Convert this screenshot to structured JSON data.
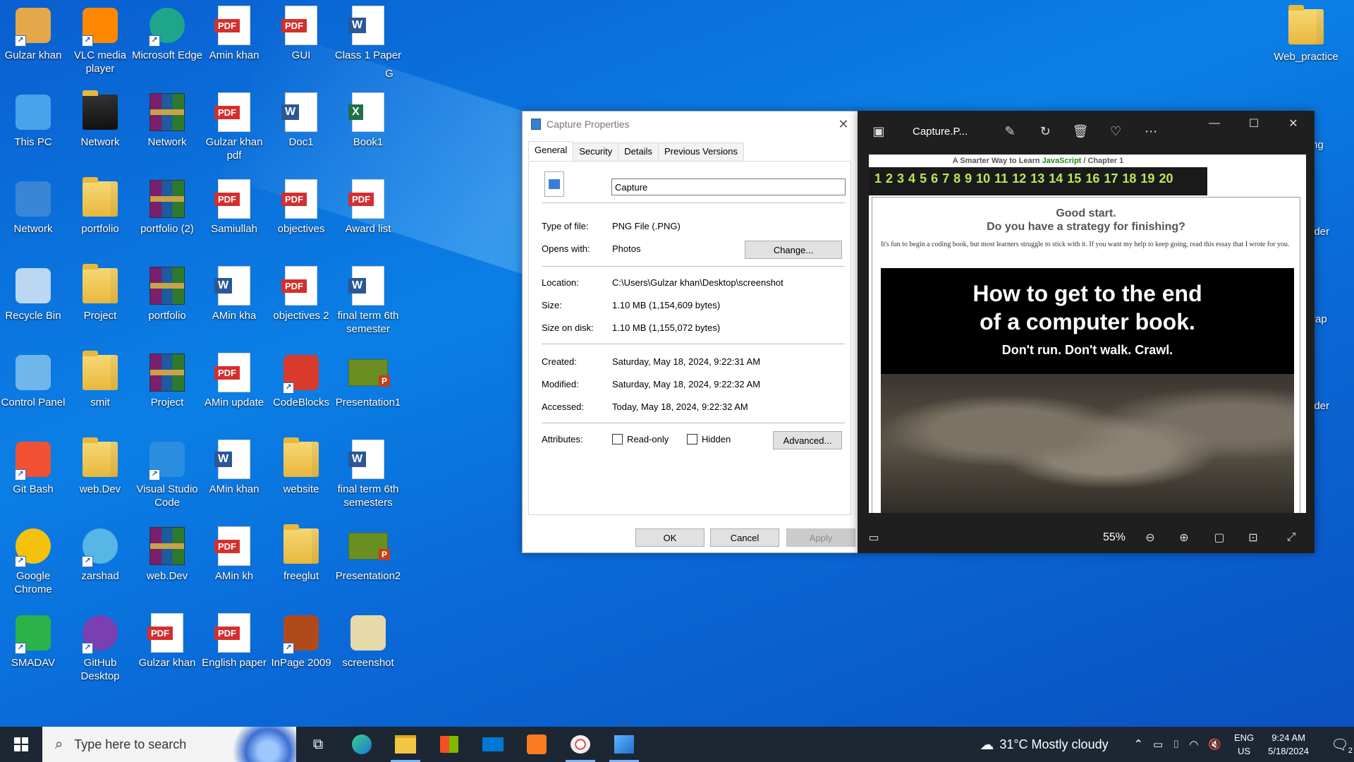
{
  "desktop": {
    "icons": [
      {
        "label": "Gulzar khan",
        "type": "user"
      },
      {
        "label": "VLC media player",
        "type": "vlc"
      },
      {
        "label": "Microsoft Edge",
        "type": "edge"
      },
      {
        "label": "Amin khan",
        "type": "pdf"
      },
      {
        "label": "GUI",
        "type": "pdf"
      },
      {
        "label": "Class 1 Paper",
        "type": "word"
      },
      {
        "label": "This PC",
        "type": "pc"
      },
      {
        "label": "Network",
        "type": "network-folder"
      },
      {
        "label": "Network",
        "type": "rar"
      },
      {
        "label": "Gulzar khan pdf",
        "type": "pdf"
      },
      {
        "label": "Doc1",
        "type": "word"
      },
      {
        "label": "Book1",
        "type": "excel"
      },
      {
        "label": "Network",
        "type": "network"
      },
      {
        "label": "portfolio",
        "type": "folder"
      },
      {
        "label": "portfolio (2)",
        "type": "rar"
      },
      {
        "label": "Samiullah",
        "type": "pdf"
      },
      {
        "label": "objectives",
        "type": "pdf"
      },
      {
        "label": "Award list",
        "type": "pdf"
      },
      {
        "label": "Recycle Bin",
        "type": "recycle"
      },
      {
        "label": "Project",
        "type": "folder"
      },
      {
        "label": "portfolio",
        "type": "rar"
      },
      {
        "label": "AMin kha",
        "type": "word"
      },
      {
        "label": "objectives 2",
        "type": "pdf"
      },
      {
        "label": "final term 6th semester",
        "type": "word"
      },
      {
        "label": "Control Panel",
        "type": "control"
      },
      {
        "label": "smit",
        "type": "folder"
      },
      {
        "label": "Project",
        "type": "rar"
      },
      {
        "label": "AMin update",
        "type": "pdf"
      },
      {
        "label": "CodeBlocks",
        "type": "codeblocks"
      },
      {
        "label": "Presentation1",
        "type": "ppt"
      },
      {
        "label": "Git Bash",
        "type": "git"
      },
      {
        "label": "web.Dev",
        "type": "folder"
      },
      {
        "label": "Visual Studio Code",
        "type": "vscode"
      },
      {
        "label": "AMin khan",
        "type": "word"
      },
      {
        "label": "website",
        "type": "folder"
      },
      {
        "label": "final term 6th semesters",
        "type": "word"
      },
      {
        "label": "Google Chrome",
        "type": "chrome"
      },
      {
        "label": "zarshad",
        "type": "edge-doc"
      },
      {
        "label": "web.Dev",
        "type": "rar"
      },
      {
        "label": "AMin kh",
        "type": "pdf"
      },
      {
        "label": "freeglut",
        "type": "folder"
      },
      {
        "label": "Presentation2",
        "type": "ppt"
      },
      {
        "label": "SMADAV",
        "type": "smadav"
      },
      {
        "label": "GitHub Desktop",
        "type": "github"
      },
      {
        "label": "Gulzar khan",
        "type": "pdf"
      },
      {
        "label": "English paper",
        "type": "pdf"
      },
      {
        "label": "InPage 2009",
        "type": "inpage"
      },
      {
        "label": "screenshot",
        "type": "image"
      }
    ],
    "right_icons": [
      {
        "label": "Web_practice"
      },
      {
        "label": "ng"
      },
      {
        "label": "lder"
      },
      {
        "label": "rap"
      },
      {
        "label": "lder"
      }
    ],
    "stray_label": "G"
  },
  "properties": {
    "title": "Capture Properties",
    "tabs": [
      "General",
      "Security",
      "Details",
      "Previous Versions"
    ],
    "filename": "Capture",
    "labels": {
      "type": "Type of file:",
      "opens": "Opens with:",
      "location": "Location:",
      "size": "Size:",
      "size_on_disk": "Size on disk:",
      "created": "Created:",
      "modified": "Modified:",
      "accessed": "Accessed:",
      "attributes": "Attributes:"
    },
    "values": {
      "type": "PNG File (.PNG)",
      "opens": "Photos",
      "location": "C:\\Users\\Gulzar khan\\Desktop\\screenshot",
      "size": "1.10 MB (1,154,609 bytes)",
      "size_on_disk": "1.10 MB (1,155,072 bytes)",
      "created": "Saturday, May 18, 2024, 9:22:31 AM",
      "modified": "Saturday, May 18, 2024, 9:22:32 AM",
      "accessed": "Today, May 18, 2024, 9:22:32 AM"
    },
    "change_btn": "Change...",
    "readonly": "Read-only",
    "hidden": "Hidden",
    "advanced_btn": "Advanced...",
    "ok": "OK",
    "cancel": "Cancel",
    "apply": "Apply"
  },
  "photos": {
    "title": "Capture.P...",
    "zoom": "55%",
    "image": {
      "header_pre": "A Smarter Way to Learn ",
      "header_js": "JavaScript",
      "header_post": "  /  Chapter 1",
      "chapters": [
        "1",
        "2",
        "3",
        "4",
        "5",
        "6",
        "7",
        "8",
        "9",
        "10",
        "11",
        "12",
        "13",
        "14",
        "15",
        "16",
        "17",
        "18",
        "19",
        "20"
      ],
      "good_start": "Good start.",
      "strategy": "Do you have a strategy for finishing?",
      "intro": "It's fun to begin a coding book, but most learners struggle to stick with it. If you want my help to keep going, read this essay that I wrote for you.",
      "banner_l1": "How to get to the end",
      "banner_l2": "of a computer book.",
      "banner_sub": "Don't run. Don't walk. Crawl."
    }
  },
  "taskbar": {
    "search_placeholder": "Type here to search",
    "weather": "31°C  Mostly cloudy",
    "lang1": "ENG",
    "lang2": "US",
    "time": "9:24 AM",
    "date": "5/18/2024",
    "notif_count": "2"
  }
}
